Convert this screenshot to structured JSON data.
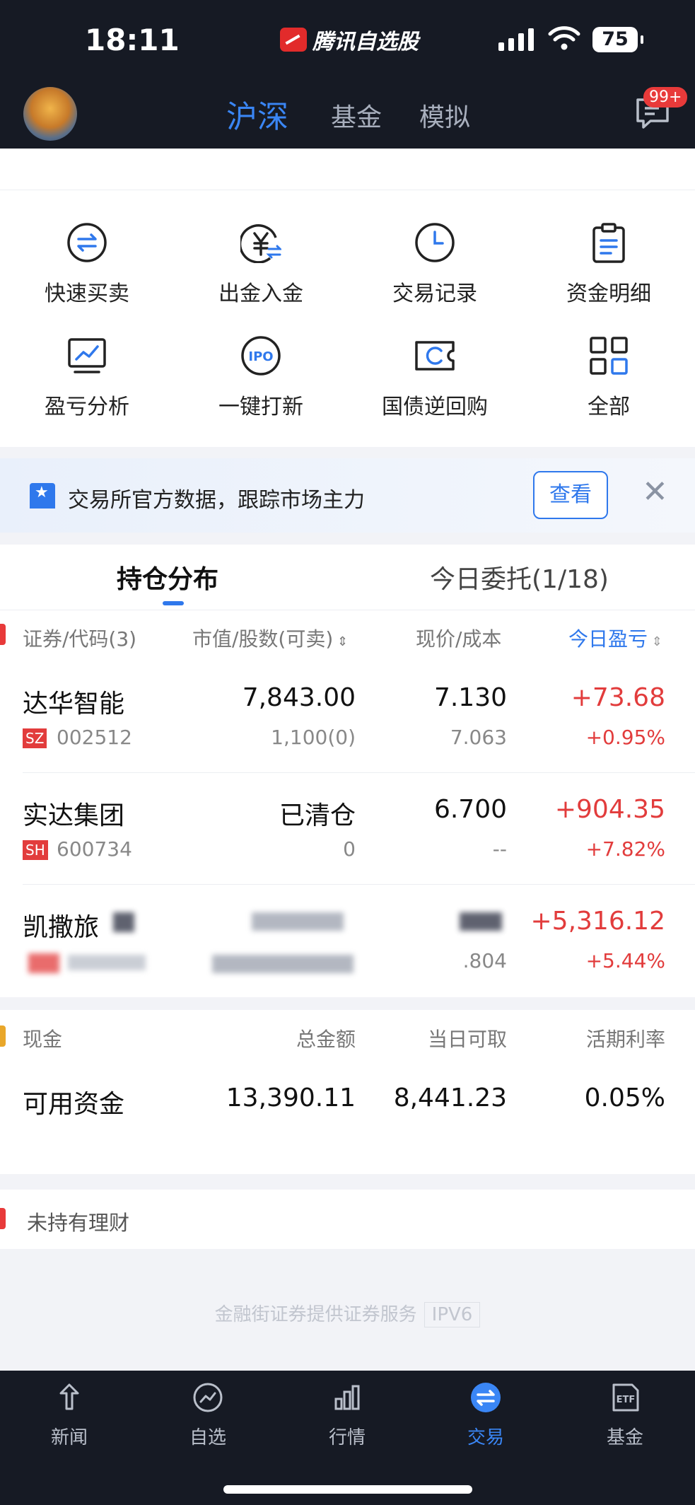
{
  "status": {
    "time": "18:11",
    "app_name": "腾讯自选股",
    "battery": "75"
  },
  "nav": {
    "tabs": [
      "沪深",
      "基金",
      "模拟"
    ],
    "badge": "99+"
  },
  "quick_actions": [
    {
      "label": "快速买卖",
      "icon": "swap-icon"
    },
    {
      "label": "出金入金",
      "icon": "yuan-transfer-icon"
    },
    {
      "label": "交易记录",
      "icon": "clock-icon"
    },
    {
      "label": "资金明细",
      "icon": "clipboard-icon"
    },
    {
      "label": "盈亏分析",
      "icon": "chart-monitor-icon"
    },
    {
      "label": "一键打新",
      "icon": "ipo-icon"
    },
    {
      "label": "国债逆回购",
      "icon": "ticket-icon"
    },
    {
      "label": "全部",
      "icon": "grid-icon"
    }
  ],
  "banner": {
    "text": "交易所官方数据，跟踪市场主力",
    "button": "查看"
  },
  "holdings": {
    "tabs": [
      "持仓分布",
      "今日委托(1/18)"
    ],
    "headers": {
      "security": "证券/代码(3)",
      "value": "市值/股数(可卖)",
      "price": "现价/成本",
      "pnl": "今日盈亏"
    },
    "rows": [
      {
        "name": "达华智能",
        "market": "SZ",
        "code": "002512",
        "value": "7,843.00",
        "shares": "1,100(0)",
        "price": "7.130",
        "cost": "7.063",
        "pnl": "+73.68",
        "pnl_pct": "+0.95%"
      },
      {
        "name": "实达集团",
        "market": "SH",
        "code": "600734",
        "value": "已清仓",
        "shares": "0",
        "price": "6.700",
        "cost": "--",
        "pnl": "+904.35",
        "pnl_pct": "+7.82%"
      },
      {
        "name": "凯撒旅",
        "market": "",
        "code": "",
        "value": "",
        "shares": "",
        "price": "",
        "cost": ".804",
        "pnl": "+5,316.12",
        "pnl_pct": "+5.44%"
      }
    ]
  },
  "cash": {
    "headers": {
      "title": "现金",
      "total": "总金额",
      "withdrawable": "当日可取",
      "rate": "活期利率"
    },
    "row": {
      "name": "可用资金",
      "total": "13,390.11",
      "withdrawable": "8,441.23",
      "rate": "0.05%"
    }
  },
  "finance": {
    "text": "未持有理财"
  },
  "footer": {
    "text": "金融街证券提供证券服务",
    "tag": "IPV6"
  },
  "tabbar": [
    {
      "label": "新闻",
      "icon": "news-icon"
    },
    {
      "label": "自选",
      "icon": "watchlist-icon"
    },
    {
      "label": "行情",
      "icon": "market-bars-icon"
    },
    {
      "label": "交易",
      "icon": "trade-icon"
    },
    {
      "label": "基金",
      "icon": "etf-icon"
    }
  ]
}
